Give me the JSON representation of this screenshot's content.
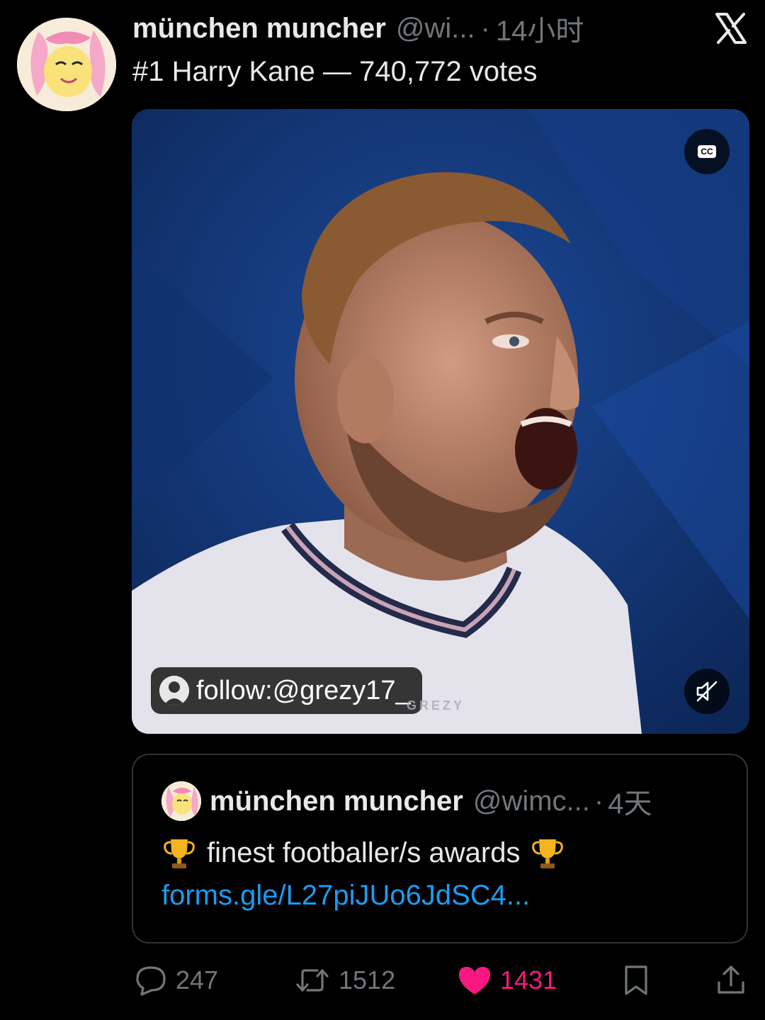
{
  "post": {
    "author_name": "münchen muncher",
    "author_handle": "@wi...",
    "separator": "·",
    "time": "14小时",
    "text": "#1 Harry Kane — 740,772 votes"
  },
  "media": {
    "cc_label": "CC",
    "follow_label": "follow:@grezy17_",
    "watermark": "GREZY",
    "muted": true
  },
  "quoted_post": {
    "author_name": "münchen muncher",
    "author_handle": "@wimc...",
    "separator": "·",
    "time": "4天",
    "text": "finest footballer/s awards",
    "link": "forms.gle/L27piJUo6JdSC4..."
  },
  "actions": {
    "replies": "247",
    "reposts": "1512",
    "likes": "1431",
    "liked": true
  },
  "colors": {
    "background": "#000000",
    "text": "#e7e9ea",
    "muted_text": "#71767b",
    "link": "#1d9bf0",
    "like": "#f91880",
    "border": "#2f3336"
  },
  "icons": [
    "x-logo-icon",
    "cc-icon",
    "mute-icon",
    "reply-icon",
    "repost-icon",
    "heart-icon",
    "bookmark-icon",
    "share-icon",
    "trophy-icon"
  ]
}
